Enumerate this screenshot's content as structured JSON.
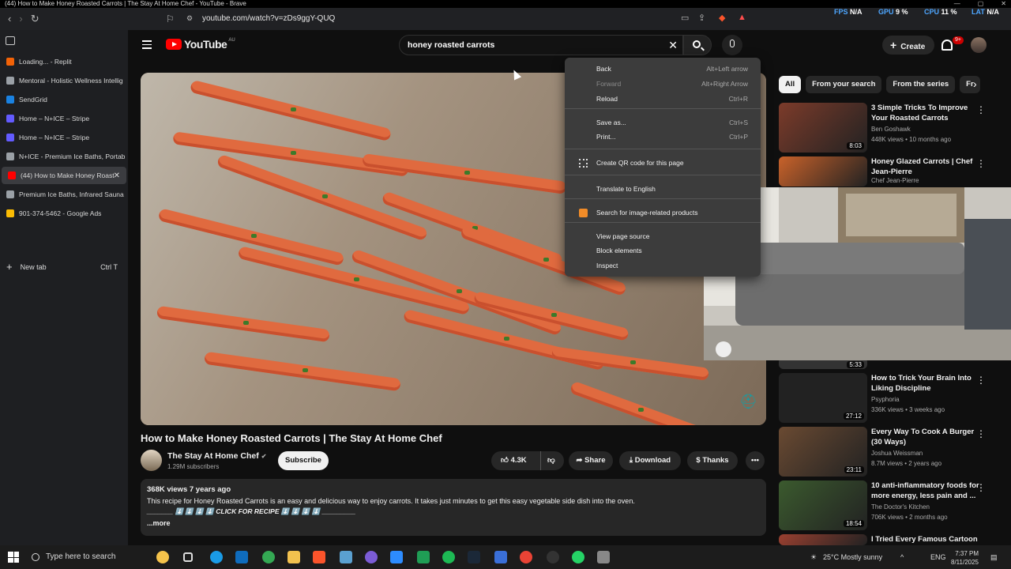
{
  "window": {
    "title": "(44) How to Make Honey Roasted Carrots | The Stay At Home Chef - YouTube - Brave"
  },
  "browser": {
    "url": "youtube.com/watch?v=zDs9ggY-QUQ",
    "hud": {
      "fps_label": "FPS",
      "fps_value": "N/A",
      "gpu_label": "GPU",
      "gpu_value": "9 %",
      "cpu_label": "CPU",
      "cpu_value": "11 %",
      "lat_label": "LAT",
      "lat_value": "N/A"
    }
  },
  "sidebar": {
    "tabs": [
      {
        "label": "Loading... - Replit",
        "color": "#f26207"
      },
      {
        "label": "Mentoral - Holistic Wellness Intellig",
        "color": "#9aa0a6"
      },
      {
        "label": "SendGrid",
        "color": "#1a82e2"
      },
      {
        "label": "Home – N+ICE – Stripe",
        "color": "#635bff"
      },
      {
        "label": "Home – N+ICE – Stripe",
        "color": "#635bff"
      },
      {
        "label": "N+ICE - Premium Ice Baths, Portabl",
        "color": "#9aa0a6"
      },
      {
        "label": "(44) How to Make Honey Roast",
        "color": "#ff0000",
        "active": true
      },
      {
        "label": "Premium Ice Baths, Infrared Sauna",
        "color": "#9aa0a6"
      },
      {
        "label": "901-374-5462 - Google Ads",
        "color": "#fbbc04"
      }
    ],
    "new_tab_label": "New tab",
    "new_tab_shortcut": "Ctrl  T"
  },
  "youtube": {
    "logo_text": "YouTube",
    "logo_region": "AU",
    "search_value": "honey roasted carrots",
    "create_label": "Create",
    "notif_count": "9+"
  },
  "video": {
    "title": "How to Make Honey Roasted Carrots | The Stay At Home Chef",
    "channel": "The Stay At Home Chef",
    "subscribers": "1.29M subscribers",
    "subscribe_label": "Subscribe",
    "likes": "4.3K",
    "share_label": "Share",
    "download_label": "Download",
    "thanks_label": "Thanks",
    "views_meta": "368K views  7 years ago",
    "description": "This recipe for Honey Roasted Carrots is an easy and delicious way to enjoy carrots. It takes just minutes to get this easy vegetable side dish into the oven.",
    "description_line2": "_______ ⬇️ ⬇️ ⬇️ ⬇️ CLICK FOR RECIPE ⬇️ ⬇️ ⬇️ ⬇️ _________",
    "more_label": "...more"
  },
  "chips": [
    "All",
    "From your search",
    "From the series",
    "Fr"
  ],
  "recommendations": [
    {
      "title": "3 Simple Tricks To Improve Your Roasted Carrots",
      "channel": "Ben Goshawk",
      "views": "448K views • 10 months ago",
      "duration": "8:03",
      "thumb": "#7c3b2a"
    },
    {
      "title": "Honey Glazed Carrots | Chef Jean-Pierre",
      "channel": "Chef Jean-Pierre",
      "views": "",
      "duration": "",
      "thumb": "#c9622a"
    },
    {
      "title": "How to Trick Your Brain Into Liking Discipline",
      "channel": "Psyphoria",
      "views": "336K views • 3 weeks ago",
      "duration": "27:12",
      "thumb": "#222222"
    },
    {
      "title": "Every Way To Cook A Burger (30 Ways)",
      "channel": "Joshua Weissman",
      "views": "8.7M views • 2 years ago",
      "duration": "23:11",
      "thumb": "#6a4a32"
    },
    {
      "title": "10 anti-inflammatory foods for more energy, less pain and ...",
      "channel": "The Doctor's Kitchen",
      "views": "706K views • 2 months ago",
      "duration": "18:54",
      "thumb": "#3b5a2e"
    },
    {
      "title": "I Tried Every Famous Cartoon",
      "channel": "",
      "views": "",
      "duration": "",
      "thumb": "#9a4030"
    }
  ],
  "partial_duration": "5:33",
  "context_menu": {
    "items": [
      {
        "label": "Back",
        "shortcut": "Alt+Left arrow",
        "disabled": false
      },
      {
        "label": "Forward",
        "shortcut": "Alt+Right Arrow",
        "disabled": true
      },
      {
        "label": "Reload",
        "shortcut": "Ctrl+R",
        "disabled": false
      },
      {
        "label": "Save as...",
        "shortcut": "Ctrl+S",
        "disabled": false
      },
      {
        "label": "Print...",
        "shortcut": "Ctrl+P",
        "disabled": false
      },
      {
        "label": "Create QR code for this page",
        "shortcut": "",
        "disabled": false
      },
      {
        "label": "Translate to English",
        "shortcut": "",
        "disabled": false
      },
      {
        "label": "Search for image-related products",
        "shortcut": "",
        "disabled": false
      },
      {
        "label": "View page source",
        "shortcut": "",
        "disabled": false
      },
      {
        "label": "Block elements",
        "shortcut": "",
        "disabled": false
      },
      {
        "label": "Inspect",
        "shortcut": "",
        "disabled": false
      }
    ]
  },
  "taskbar": {
    "search_placeholder": "Type here to search",
    "weather": "25°C  Mostly sunny",
    "lang": "ENG",
    "time": "7:37 PM",
    "date": "8/11/2025"
  }
}
